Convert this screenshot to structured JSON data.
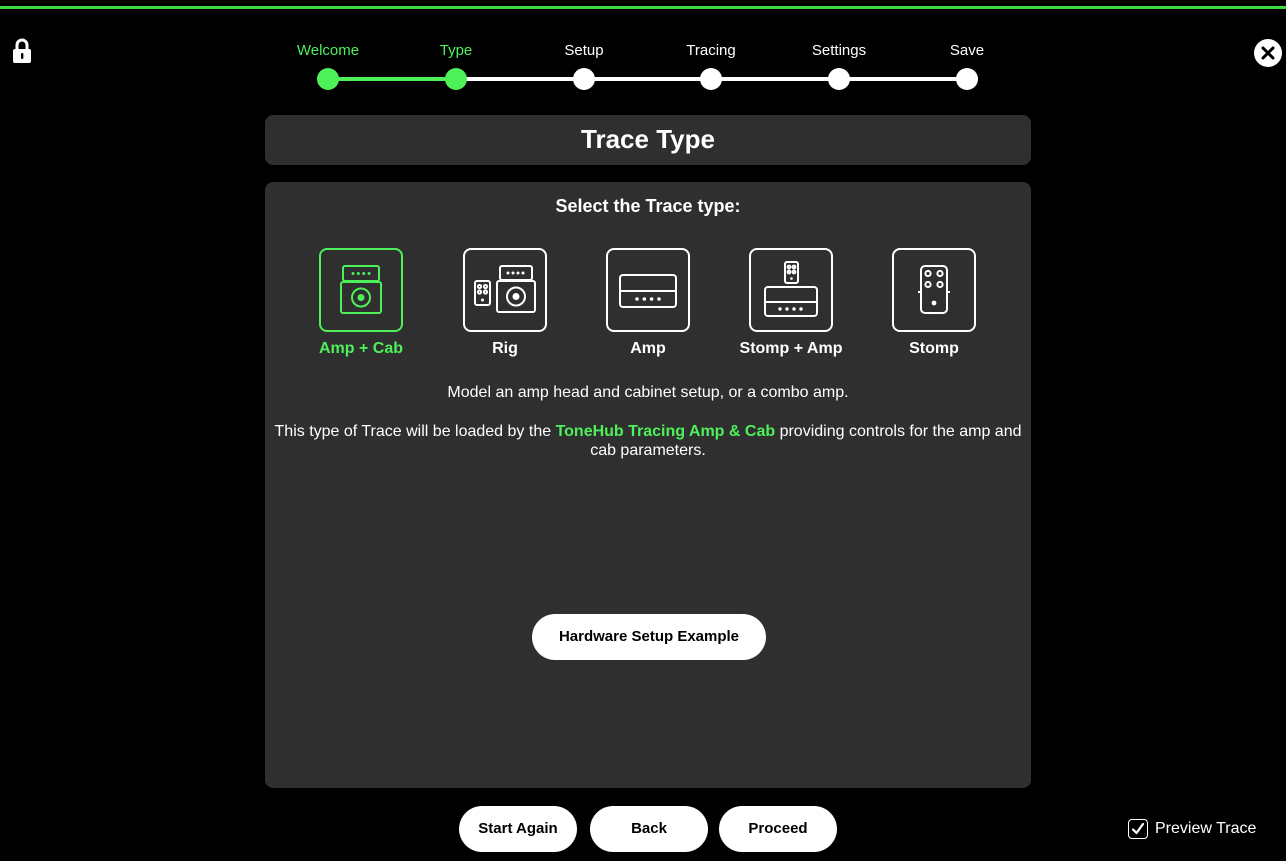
{
  "wizard": {
    "steps": [
      {
        "label": "Welcome",
        "done": true
      },
      {
        "label": "Type",
        "done": true
      },
      {
        "label": "Setup",
        "done": false
      },
      {
        "label": "Tracing",
        "done": false
      },
      {
        "label": "Settings",
        "done": false
      },
      {
        "label": "Save",
        "done": false
      }
    ]
  },
  "title": "Trace Type",
  "main": {
    "heading": "Select the Trace type:",
    "types": [
      {
        "label": "Amp + Cab",
        "icon": "amp-cab-icon",
        "selected": true
      },
      {
        "label": "Rig",
        "icon": "rig-icon",
        "selected": false
      },
      {
        "label": "Amp",
        "icon": "amp-icon",
        "selected": false
      },
      {
        "label": "Stomp + Amp",
        "icon": "stomp-amp-icon",
        "selected": false
      },
      {
        "label": "Stomp",
        "icon": "stomp-icon",
        "selected": false
      }
    ],
    "description": "Model an amp head and cabinet setup, or a combo amp.",
    "detail_prefix": "This type of Trace will be loaded by the ",
    "detail_highlight": "ToneHub Tracing Amp & Cab",
    "detail_suffix": " providing controls for the amp and cab parameters.",
    "hardware_button": "Hardware Setup Example"
  },
  "footer": {
    "start_again": "Start Again",
    "back": "Back",
    "proceed": "Proceed",
    "preview_label": "Preview Trace",
    "preview_checked": true
  },
  "colors": {
    "accent": "#4ef05a",
    "background": "#000000",
    "panel": "#2f2f2f"
  }
}
